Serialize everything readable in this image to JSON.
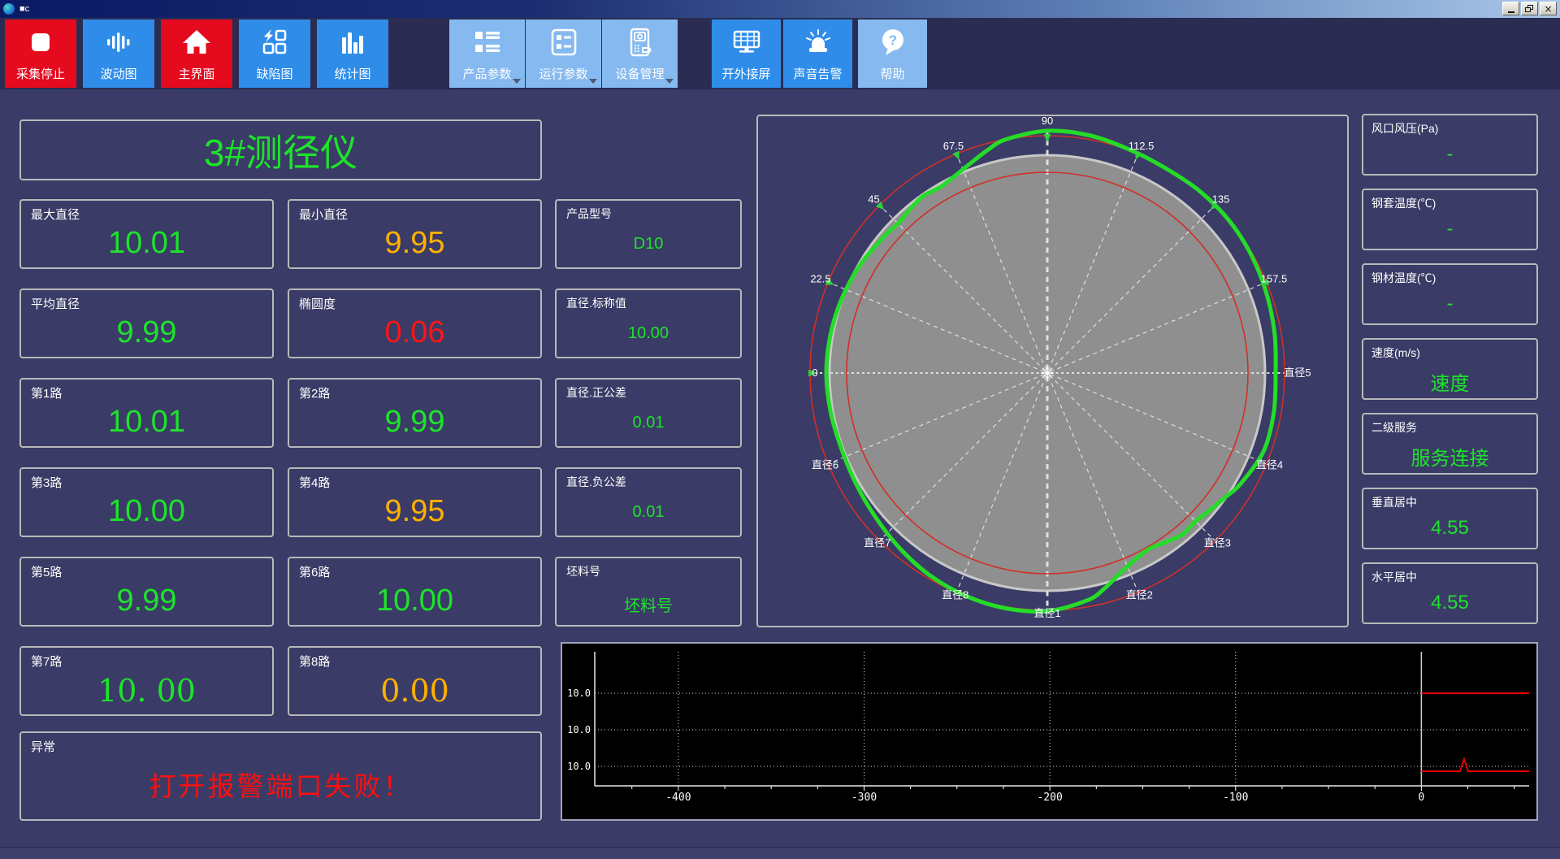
{
  "window": {
    "title": "■c"
  },
  "toolbar": {
    "buttons": [
      {
        "id": "stop-acquisition",
        "label": "采集停止",
        "color": "red",
        "icon": "stop-icon"
      },
      {
        "id": "wave-chart",
        "label": "波动图",
        "color": "blue",
        "icon": "waveform-icon"
      },
      {
        "id": "main-screen",
        "label": "主界面",
        "color": "red",
        "icon": "home-icon"
      },
      {
        "id": "defect-chart",
        "label": "缺陷图",
        "color": "blue",
        "icon": "defect-grid-icon"
      },
      {
        "id": "statistics-chart",
        "label": "统计图",
        "color": "blue",
        "icon": "bar-chart-icon"
      },
      {
        "id": "product-params",
        "label": "产品参数",
        "color": "lightblue",
        "icon": "product-list-icon",
        "dropdown": true
      },
      {
        "id": "run-params",
        "label": "运行参数",
        "color": "lightblue",
        "icon": "form-icon",
        "dropdown": true
      },
      {
        "id": "device-management",
        "label": "设备管理",
        "color": "lightblue",
        "icon": "device-icon",
        "dropdown": true
      },
      {
        "id": "external-screen",
        "label": "开外接屏",
        "color": "blue",
        "icon": "monitor-icon"
      },
      {
        "id": "sound-alarm",
        "label": "声音告警",
        "color": "blue",
        "icon": "siren-icon"
      },
      {
        "id": "help",
        "label": "帮助",
        "color": "lightblue",
        "icon": "help-icon"
      }
    ]
  },
  "header": {
    "title": "3#测径仪"
  },
  "metrics": [
    {
      "label": "最大直径",
      "value": "10.01",
      "color": "green"
    },
    {
      "label": "最小直径",
      "value": "9.95",
      "color": "orange"
    },
    {
      "label": "平均直径",
      "value": "9.99",
      "color": "green"
    },
    {
      "label": "椭圆度",
      "value": "0.06",
      "color": "red"
    },
    {
      "label": "第1路",
      "value": "10.01",
      "color": "green"
    },
    {
      "label": "第2路",
      "value": "9.99",
      "color": "green"
    },
    {
      "label": "第3路",
      "value": "10.00",
      "color": "green"
    },
    {
      "label": "第4路",
      "value": "9.95",
      "color": "orange"
    },
    {
      "label": "第5路",
      "value": "9.99",
      "color": "green"
    },
    {
      "label": "第6路",
      "value": "10.00",
      "color": "green"
    },
    {
      "label": "第7路",
      "value": "10. 00",
      "color": "green",
      "serif": true
    },
    {
      "label": "第8路",
      "value": "0.00",
      "color": "orange",
      "serif": true
    }
  ],
  "params": [
    {
      "label": "产品型号",
      "value": "D10"
    },
    {
      "label": "直径.标称值",
      "value": "10.00"
    },
    {
      "label": "直径.正公差",
      "value": "0.01"
    },
    {
      "label": "直径.负公差",
      "value": "0.01"
    },
    {
      "label": "坯料号",
      "value": "坯料号"
    }
  ],
  "alarm": {
    "label": "异常",
    "message": "打开报警端口失败！"
  },
  "sidebar": [
    {
      "label": "风口风压(Pa)",
      "value": "-"
    },
    {
      "label": "钢套温度(℃)",
      "value": "-"
    },
    {
      "label": "钢材温度(℃)",
      "value": "-"
    },
    {
      "label": "速度(m/s)",
      "value": "速度"
    },
    {
      "label": "二级服务",
      "value": "服务连接"
    },
    {
      "label": "垂直居中",
      "value": "4.55"
    },
    {
      "label": "水平居中",
      "value": "4.55"
    }
  ],
  "colors": {
    "value_green": "#1de32b",
    "value_orange": "#ffb000",
    "value_red": "#ff1515",
    "profile_green": "#25dc28",
    "tolerance_red": "#d03028",
    "nominal_gray": "#8f8f8f",
    "grid_white": "#e4e4e4"
  },
  "chart_data": [
    {
      "id": "cross-section-polar",
      "type": "line",
      "subtype": "polar-profile",
      "title": "",
      "angle_labels": [
        {
          "text": "0",
          "deg": 180
        },
        {
          "text": "22.5",
          "deg": 157.5
        },
        {
          "text": "45",
          "deg": 135
        },
        {
          "text": "67.5",
          "deg": 112.5
        },
        {
          "text": "90",
          "deg": 90
        },
        {
          "text": "112.5",
          "deg": 67.5
        },
        {
          "text": "135",
          "deg": 45
        },
        {
          "text": "157.5",
          "deg": 22.5
        }
      ],
      "diameter_labels": [
        {
          "text": "直径5",
          "deg": 0
        },
        {
          "text": "直径4",
          "deg": -22.5
        },
        {
          "text": "直径3",
          "deg": -45
        },
        {
          "text": "直径2",
          "deg": -67.5
        },
        {
          "text": "直径1",
          "deg": -90
        },
        {
          "text": "直径8",
          "deg": -112.5
        },
        {
          "text": "直径7",
          "deg": -135
        },
        {
          "text": "直径6",
          "deg": -157.5
        }
      ],
      "rings": {
        "nominal_r": 268,
        "outer_tolerance_r": 292,
        "inner_tolerance_r": 247
      },
      "spoke_step_deg": 22.5,
      "profile_points": [
        [
          0,
          281
        ],
        [
          10,
          284
        ],
        [
          20,
          287
        ],
        [
          30,
          290
        ],
        [
          40,
          292
        ],
        [
          50,
          292
        ],
        [
          60,
          291
        ],
        [
          70,
          293
        ],
        [
          80,
          297
        ],
        [
          90,
          298
        ],
        [
          100,
          292
        ],
        [
          105,
          284
        ],
        [
          110,
          275
        ],
        [
          115,
          268
        ],
        [
          120,
          264
        ],
        [
          125,
          266
        ],
        [
          130,
          263
        ],
        [
          135,
          260
        ],
        [
          140,
          262
        ],
        [
          150,
          266
        ],
        [
          160,
          269
        ],
        [
          170,
          271
        ],
        [
          180,
          272
        ],
        [
          190,
          271
        ],
        [
          200,
          270
        ],
        [
          210,
          272
        ],
        [
          220,
          276
        ],
        [
          230,
          282
        ],
        [
          240,
          288
        ],
        [
          250,
          292
        ],
        [
          260,
          294
        ],
        [
          270,
          293
        ],
        [
          280,
          284
        ],
        [
          285,
          274
        ],
        [
          290,
          262
        ],
        [
          295,
          254
        ],
        [
          300,
          250
        ],
        [
          305,
          254
        ],
        [
          310,
          259
        ],
        [
          315,
          258
        ],
        [
          320,
          262
        ],
        [
          325,
          267
        ],
        [
          330,
          274
        ],
        [
          340,
          283
        ],
        [
          350,
          283
        ]
      ],
      "legend": "green curve = measured cross-section profile, red circles = tolerance limits, gray disc = nominal section"
    },
    {
      "id": "diameter-history-strip",
      "type": "line",
      "bg": "#000000",
      "x_ticks": [
        -400,
        -300,
        -200,
        -100,
        0
      ],
      "x_range": [
        -445,
        58
      ],
      "y_gridline_labels": [
        "10.0",
        "10.0",
        "10.0"
      ],
      "cursor_line_x": 0,
      "series": [
        {
          "name": "upper-line",
          "color": "#e60000",
          "y_level": "gridline-1",
          "x_start": 0
        },
        {
          "name": "lower-trace",
          "color": "#e60000",
          "y_level": "below-gridline-3",
          "x_start": 0,
          "spike_x": 23
        }
      ]
    }
  ]
}
